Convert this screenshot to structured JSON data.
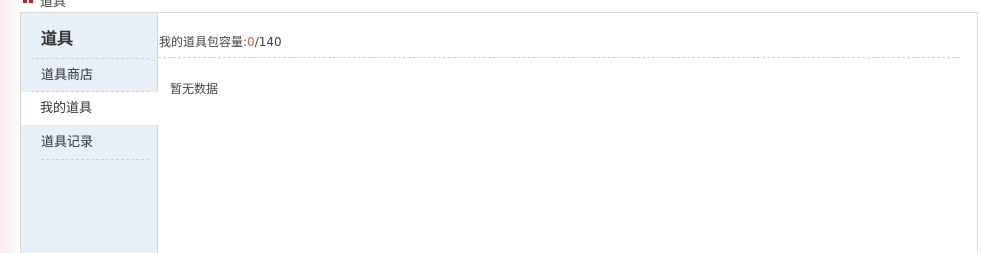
{
  "header": {
    "icon": "red-grid-icon",
    "title": "道具"
  },
  "sidebar": {
    "title": "道具",
    "items": [
      {
        "label": "道具商店",
        "active": false
      },
      {
        "label": "我的道具",
        "active": true
      },
      {
        "label": "道具记录",
        "active": false
      }
    ]
  },
  "main": {
    "capacity_label": "我的道具包容量:",
    "capacity_used": "0",
    "capacity_total": "/140",
    "empty_text": "暂无数据"
  },
  "colors": {
    "sidebar_bg": "#e7eff7",
    "accent_red": "#c81a1a",
    "used_value": "#e05a37"
  }
}
